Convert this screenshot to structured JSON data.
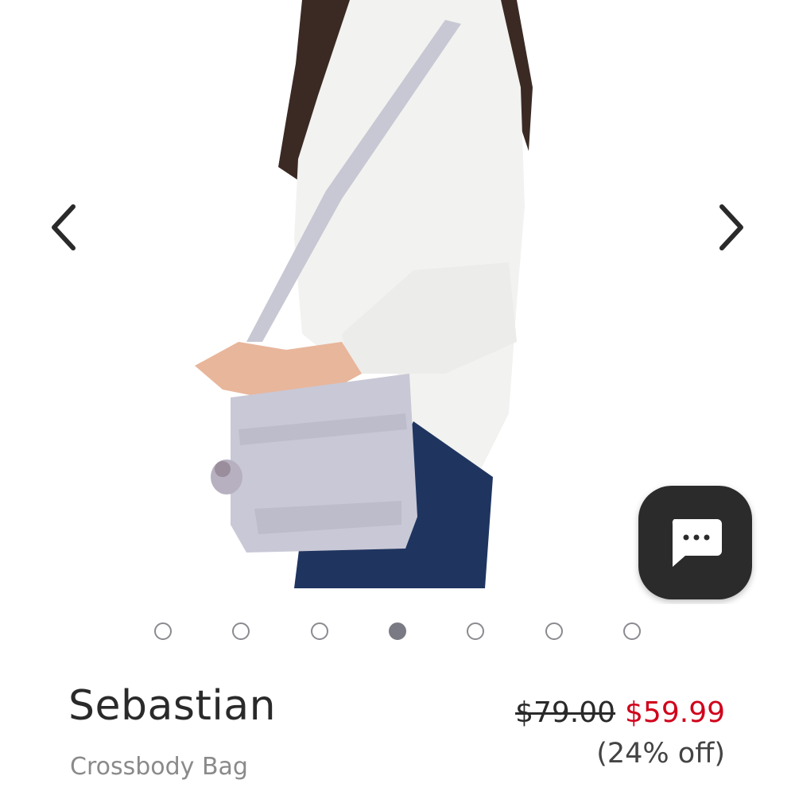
{
  "gallery": {
    "image_alt": "Woman wearing a light grey crossbody bag",
    "total_slides": 7,
    "active_slide": 4
  },
  "chat": {
    "icon": "chat-bubble-icon"
  },
  "product": {
    "name": "Sebastian",
    "subtitle": "Crossbody Bag",
    "original_price": "$79.00",
    "sale_price": "$59.99",
    "discount": "(24% off)"
  },
  "colors": {
    "sale": "#d0021b",
    "chat_bg": "#2b2b2b",
    "dot_active": "#7a7a84"
  }
}
